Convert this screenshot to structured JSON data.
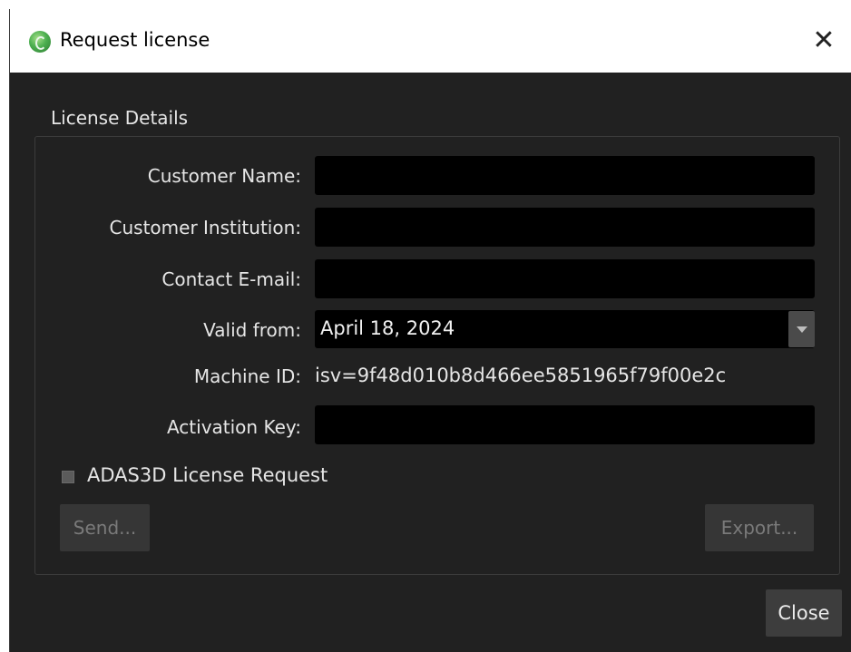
{
  "window": {
    "title": "Request license",
    "close_glyph": "✕"
  },
  "group": {
    "title": "License Details"
  },
  "form": {
    "customer_name_label": "Customer Name:",
    "customer_name_value": "",
    "customer_institution_label": "Customer Institution:",
    "customer_institution_value": "",
    "contact_email_label": "Contact E-mail:",
    "contact_email_value": "",
    "valid_from_label": "Valid from:",
    "valid_from_value": "April 18, 2024",
    "machine_id_label": "Machine ID:",
    "machine_id_value": "isv=9f48d010b8d466ee5851965f79f00e2c",
    "activation_key_label": "Activation Key:",
    "activation_key_value": ""
  },
  "checkbox": {
    "label": "ADAS3D License Request",
    "checked": false
  },
  "buttons": {
    "send": "Send...",
    "export": "Export...",
    "close": "Close"
  },
  "colors": {
    "background": "#212121",
    "field": "#000000",
    "text": "#e6e6e6",
    "disabled_text": "#7a7a7a"
  },
  "icons": {
    "app": "green-circle-app-icon",
    "window_close": "close-icon",
    "date_dropdown": "chevron-down-icon"
  }
}
